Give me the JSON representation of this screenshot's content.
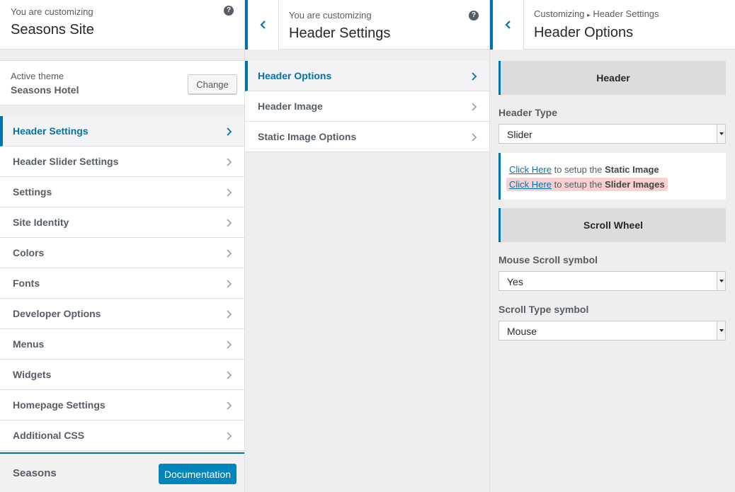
{
  "panel1": {
    "customizing_label": "You are customizing",
    "site_title": "Seasons Site",
    "help_glyph": "?",
    "active_theme_label": "Active theme",
    "theme_name": "Seasons Hotel",
    "change_label": "Change",
    "menu": [
      {
        "label": "Header Settings",
        "active": true
      },
      {
        "label": "Header Slider Settings"
      },
      {
        "label": "Settings"
      },
      {
        "label": "Site Identity"
      },
      {
        "label": "Colors"
      },
      {
        "label": "Fonts"
      },
      {
        "label": "Developer Options"
      },
      {
        "label": "Menus"
      },
      {
        "label": "Widgets"
      },
      {
        "label": "Homepage Settings"
      },
      {
        "label": "Additional CSS"
      }
    ],
    "footer_name": "Seasons",
    "documentation_label": "Documentation"
  },
  "panel2": {
    "customizing_label": "You are customizing",
    "title": "Header Settings",
    "help_glyph": "?",
    "menu": [
      {
        "label": "Header Options",
        "active": true
      },
      {
        "label": "Header Image"
      },
      {
        "label": "Static Image Options"
      }
    ]
  },
  "panel3": {
    "breadcrumb_root": "Customizing",
    "breadcrumb_sep": "▸",
    "breadcrumb_parent": "Header Settings",
    "title": "Header Options",
    "section_header": "Header",
    "header_type_label": "Header Type",
    "header_type_value": "Slider",
    "link1_text": "Click Here",
    "link1_mid": " to setup the ",
    "link1_bold": "Static Image",
    "link2_text": "Click Here",
    "link2_mid": " to setup the ",
    "link2_bold": "Slider Images",
    "section_scroll": "Scroll Wheel",
    "mouse_scroll_label": "Mouse Scroll symbol",
    "mouse_scroll_value": "Yes",
    "scroll_type_label": "Scroll Type symbol",
    "scroll_type_value": "Mouse"
  },
  "colors": {
    "accent": "#0073aa",
    "button_primary": "#0085ba",
    "highlight": "#f9cfcf"
  }
}
